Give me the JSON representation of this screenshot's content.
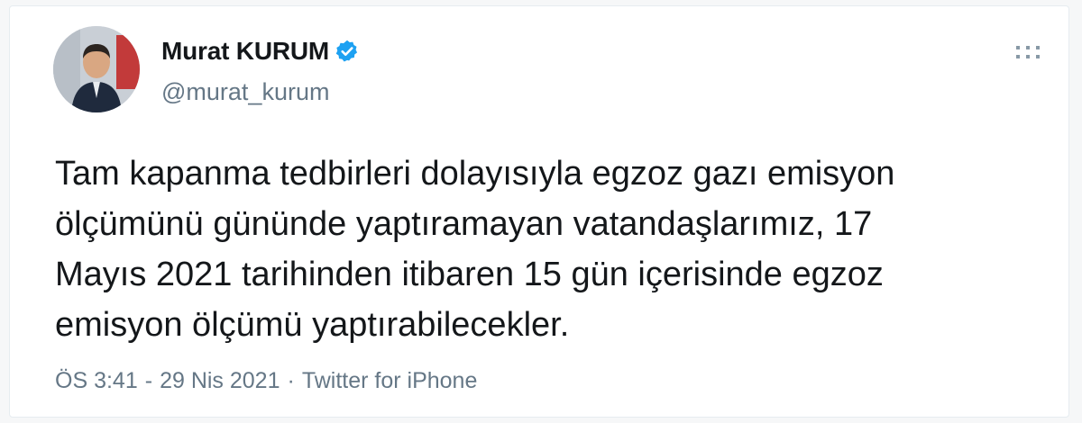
{
  "tweet": {
    "author": {
      "display_name": "Murat KURUM",
      "handle": "@murat_kurum",
      "verified": true,
      "avatar_icon": "user-avatar-photo"
    },
    "more_icon": "more-dots-icon",
    "text": "Tam kapanma tedbirleri dolayısıyla egzoz gazı emisyon\nölçümünü gününde yaptıramayan vatandaşlarımız, 17\nMayıs 2021 tarihinden itibaren 15 gün içerisinde egzoz\nemisyon ölçümü yaptırabilecekler.",
    "meta": {
      "time": "ÖS 3:41",
      "date": "29 Nis 2021",
      "source": "Twitter for iPhone",
      "separator": "·",
      "dash": "-"
    }
  },
  "colors": {
    "verified_badge": "#1da1f2",
    "text_primary": "#14171a",
    "text_secondary": "#657786",
    "card_border": "#e6ecf0"
  }
}
